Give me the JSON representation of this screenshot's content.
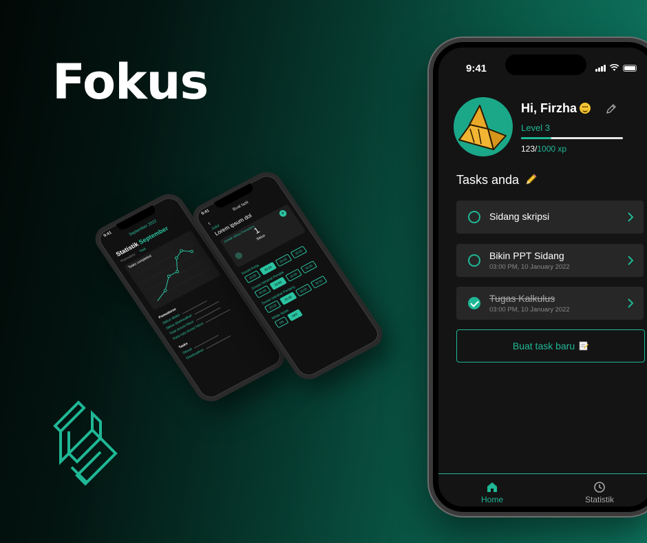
{
  "brand": {
    "title": "Fokus"
  },
  "colors": {
    "accent": "#1fb896",
    "background_dark": "#141414",
    "card": "#272727"
  },
  "main_phone": {
    "status": {
      "time": "9:41"
    },
    "profile": {
      "greeting": "Hi, Firzha",
      "level": "Level 3",
      "xp_current": "123",
      "xp_max": "1000 xp",
      "xp_progress": 0.3
    },
    "tasks_header": "Tasks anda",
    "tasks": [
      {
        "name": "Sidang skripsi",
        "date": "",
        "done": false
      },
      {
        "name": "Bikin PPT Sidang",
        "date": "03:00 PM, 10 January 2022",
        "done": false
      },
      {
        "name": "Tugas Kalkulus",
        "date": "03:00 PM, 10 January 2022",
        "done": true
      }
    ],
    "new_task_label": "Buat task baru",
    "nav": [
      {
        "label": "Home",
        "icon": "home-icon",
        "active": true
      },
      {
        "label": "Statistik",
        "icon": "clock-icon",
        "active": false
      }
    ]
  },
  "stat_phone": {
    "time": "9:41",
    "header": "September 2022",
    "title": "Statistik",
    "title_accent": "September",
    "tabs": [
      "Pomodoro",
      "Task"
    ],
    "chart_label": "Tasks completed",
    "section_pomodoro": "Pomodoros",
    "rows": [
      "Siklus dilalui",
      "Siklus diselesaikan",
      "Total durasi fokus",
      "Rata-rata durasi fokus"
    ],
    "section_tasks": "Tasks",
    "task_rows": [
      "Dibuat",
      "Diselesaikan"
    ]
  },
  "task_phone": {
    "time": "9:41",
    "header": "Buat task",
    "judul_label": "Judul",
    "judul_value": "Lorem ipsum dol",
    "cycle_label": "Jumlah Siklus Pomodoro",
    "cycle_value": "1",
    "cycle_unit": "Siklus",
    "durasi_kerja": "Durasi Kerja",
    "durasi_kerja_opts": [
      "15:00",
      "20:00",
      "25:00",
      "30:00"
    ],
    "istirahat_pendek": "Durasi Istirahat Pendek",
    "istirahat_pendek_opts": [
      "05:00",
      "10:00",
      "15:00",
      "20:00"
    ],
    "istirahat_panjang": "Durasi Istirahat Panjang",
    "istirahat_panjang_opts": [
      "20:00",
      "25:00",
      "30:00",
      "35:00"
    ],
    "white_noise": "White Noise",
    "noise_opts": [
      "ON",
      "OFF"
    ]
  }
}
